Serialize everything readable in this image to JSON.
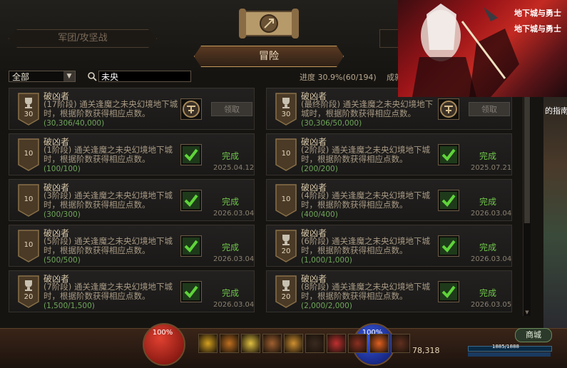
{
  "tabs": {
    "guild_war": "军团/攻坚战",
    "adventure": "冒险"
  },
  "filters": {
    "category": "全部",
    "search_value": "未央",
    "progress_label": "进度",
    "progress_value": "30.9%(60/194)",
    "extra_label": "成就"
  },
  "cards": [
    {
      "points": "30",
      "badge": "cup",
      "title": "破凶者",
      "desc": "(17阶段) 通关逢魔之未央幻境地下城时，根据阶数获得相应点数。",
      "count": "(30,306/40,000)",
      "state": "claim",
      "action": "领取",
      "date": ""
    },
    {
      "points": "30",
      "badge": "cup",
      "title": "破凶者",
      "desc": "(最终阶段) 通关逢魔之未央幻境地下城时，根据阶数获得相应点数。",
      "count": "(30,306/50,000)",
      "state": "claim",
      "action": "领取",
      "date": ""
    },
    {
      "points": "10",
      "badge": "plain",
      "title": "破凶者",
      "desc": "(1阶段) 通关逢魔之未央幻境地下城时，根据阶数获得相应点数。",
      "count": "(100/100)",
      "state": "done",
      "action": "完成",
      "date": "2025.04.12"
    },
    {
      "points": "10",
      "badge": "plain",
      "title": "破凶者",
      "desc": "(2阶段) 通关逢魔之未央幻境地下城时，根据阶数获得相应点数。",
      "count": "(200/200)",
      "state": "done",
      "action": "完成",
      "date": "2025.07.21"
    },
    {
      "points": "10",
      "badge": "plain",
      "title": "破凶者",
      "desc": "(3阶段) 通关逢魔之未央幻境地下城时，根据阶数获得相应点数。",
      "count": "(300/300)",
      "state": "done",
      "action": "完成",
      "date": "2026.03.04"
    },
    {
      "points": "10",
      "badge": "plain",
      "title": "破凶者",
      "desc": "(4阶段) 通关逢魔之未央幻境地下城时，根据阶数获得相应点数。",
      "count": "(400/400)",
      "state": "done",
      "action": "完成",
      "date": "2026.03.04"
    },
    {
      "points": "10",
      "badge": "plain",
      "title": "破凶者",
      "desc": "(5阶段) 通关逢魔之未央幻境地下城时，根据阶数获得相应点数。",
      "count": "(500/500)",
      "state": "done",
      "action": "完成",
      "date": "2026.03.04"
    },
    {
      "points": "20",
      "badge": "cup",
      "title": "破凶者",
      "desc": "(6阶段) 通关逢魔之未央幻境地下城时，根据阶数获得相应点数。",
      "count": "(1,000/1,000)",
      "state": "done",
      "action": "完成",
      "date": "2026.03.04"
    },
    {
      "points": "20",
      "badge": "cup",
      "title": "破凶者",
      "desc": "(7阶段) 通关逢魔之未央幻境地下城时，根据阶数获得相应点数。",
      "count": "(1,500/1,500)",
      "state": "done",
      "action": "完成",
      "date": "2026.03.04"
    },
    {
      "points": "20",
      "badge": "cup",
      "title": "破凶者",
      "desc": "(8阶段) 通关逢魔之未央幻境地下城时，根据阶数获得相应点数。",
      "count": "(2,000/2,000)",
      "state": "done",
      "action": "完成",
      "date": "2026.03.05"
    }
  ],
  "banner": {
    "brand_line1": "地下城与勇士",
    "brand_line2": "地下城与勇士"
  },
  "side": {
    "guide_text": "的指南"
  },
  "hud": {
    "hp_percent": "100%",
    "mp_percent": "100%",
    "gold": "78,318",
    "shop": "商城",
    "exp_text": "1885/1888"
  },
  "colors": {
    "accent": "#c79a5c",
    "done": "#6fc64a",
    "check": "#3fae2a"
  }
}
